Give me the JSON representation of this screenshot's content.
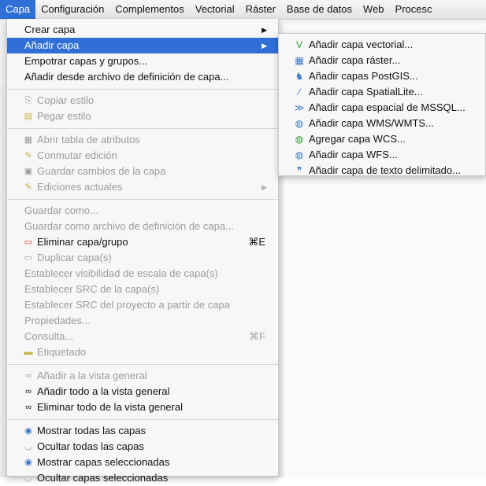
{
  "menubar": {
    "items": [
      "Capa",
      "Configuración",
      "Complementos",
      "Vectorial",
      "Ráster",
      "Base de datos",
      "Web",
      "Procesc"
    ]
  },
  "menu": {
    "crear_capa": "Crear capa",
    "anadir_capa": "Añadir capa",
    "empotrar": "Empotrar capas y grupos...",
    "anadir_desde_archivo": "Añadir desde archivo de definición de capa...",
    "copiar_estilo": "Copiar estilo",
    "pegar_estilo": "Pegar estilo",
    "abrir_tabla": "Abrir tabla de atributos",
    "conmutar_edicion": "Conmutar edición",
    "guardar_cambios": "Guardar cambios de la capa",
    "ediciones_actuales": "Ediciones actuales",
    "guardar_como": "Guardar como...",
    "guardar_como_def": "Guardar como archivo de definición de capa...",
    "eliminar_capa": "Eliminar capa/grupo",
    "eliminar_shortcut": "⌘E",
    "duplicar_capa": "Duplicar capa(s)",
    "establecer_visibilidad": "Establecer visibilidad de escala de capa(s)",
    "establecer_src": "Establecer SRC de la capa(s)",
    "establecer_src_proyecto": "Establecer SRC del proyecto a partir de capa",
    "propiedades": "Propiedades...",
    "consulta": "Consulta...",
    "consulta_shortcut": "⌘F",
    "etiquetado": "Etiquetado",
    "anadir_vista": "Añadir a la vista general",
    "anadir_todo_vista": "Añadir todo a la vista general",
    "eliminar_todo_vista": "Eliminar todo de la vista general",
    "mostrar_todas": "Mostrar todas las capas",
    "ocultar_todas": "Ocultar todas las capas",
    "mostrar_seleccionadas": "Mostrar capas seleccionadas",
    "ocultar_seleccionadas": "Ocultar capas seleccionadas"
  },
  "submenu": {
    "vectorial": "Añadir capa vectorial...",
    "raster": "Añadir capa ráster...",
    "postgis": "Añadir capas PostGIS...",
    "spatialite": "Añadir capa SpatialLite...",
    "mssql": "Añadir capa espacial de MSSQL...",
    "wms": "Añadir capa WMS/WMTS...",
    "wcs": "Agregar capa WCS...",
    "wfs": "Añadir capa WFS...",
    "texto": "Añadir capa de texto delimitado..."
  },
  "colors": {
    "highlight": "#2f6fd6",
    "disabled_text": "#9c9c9c"
  }
}
